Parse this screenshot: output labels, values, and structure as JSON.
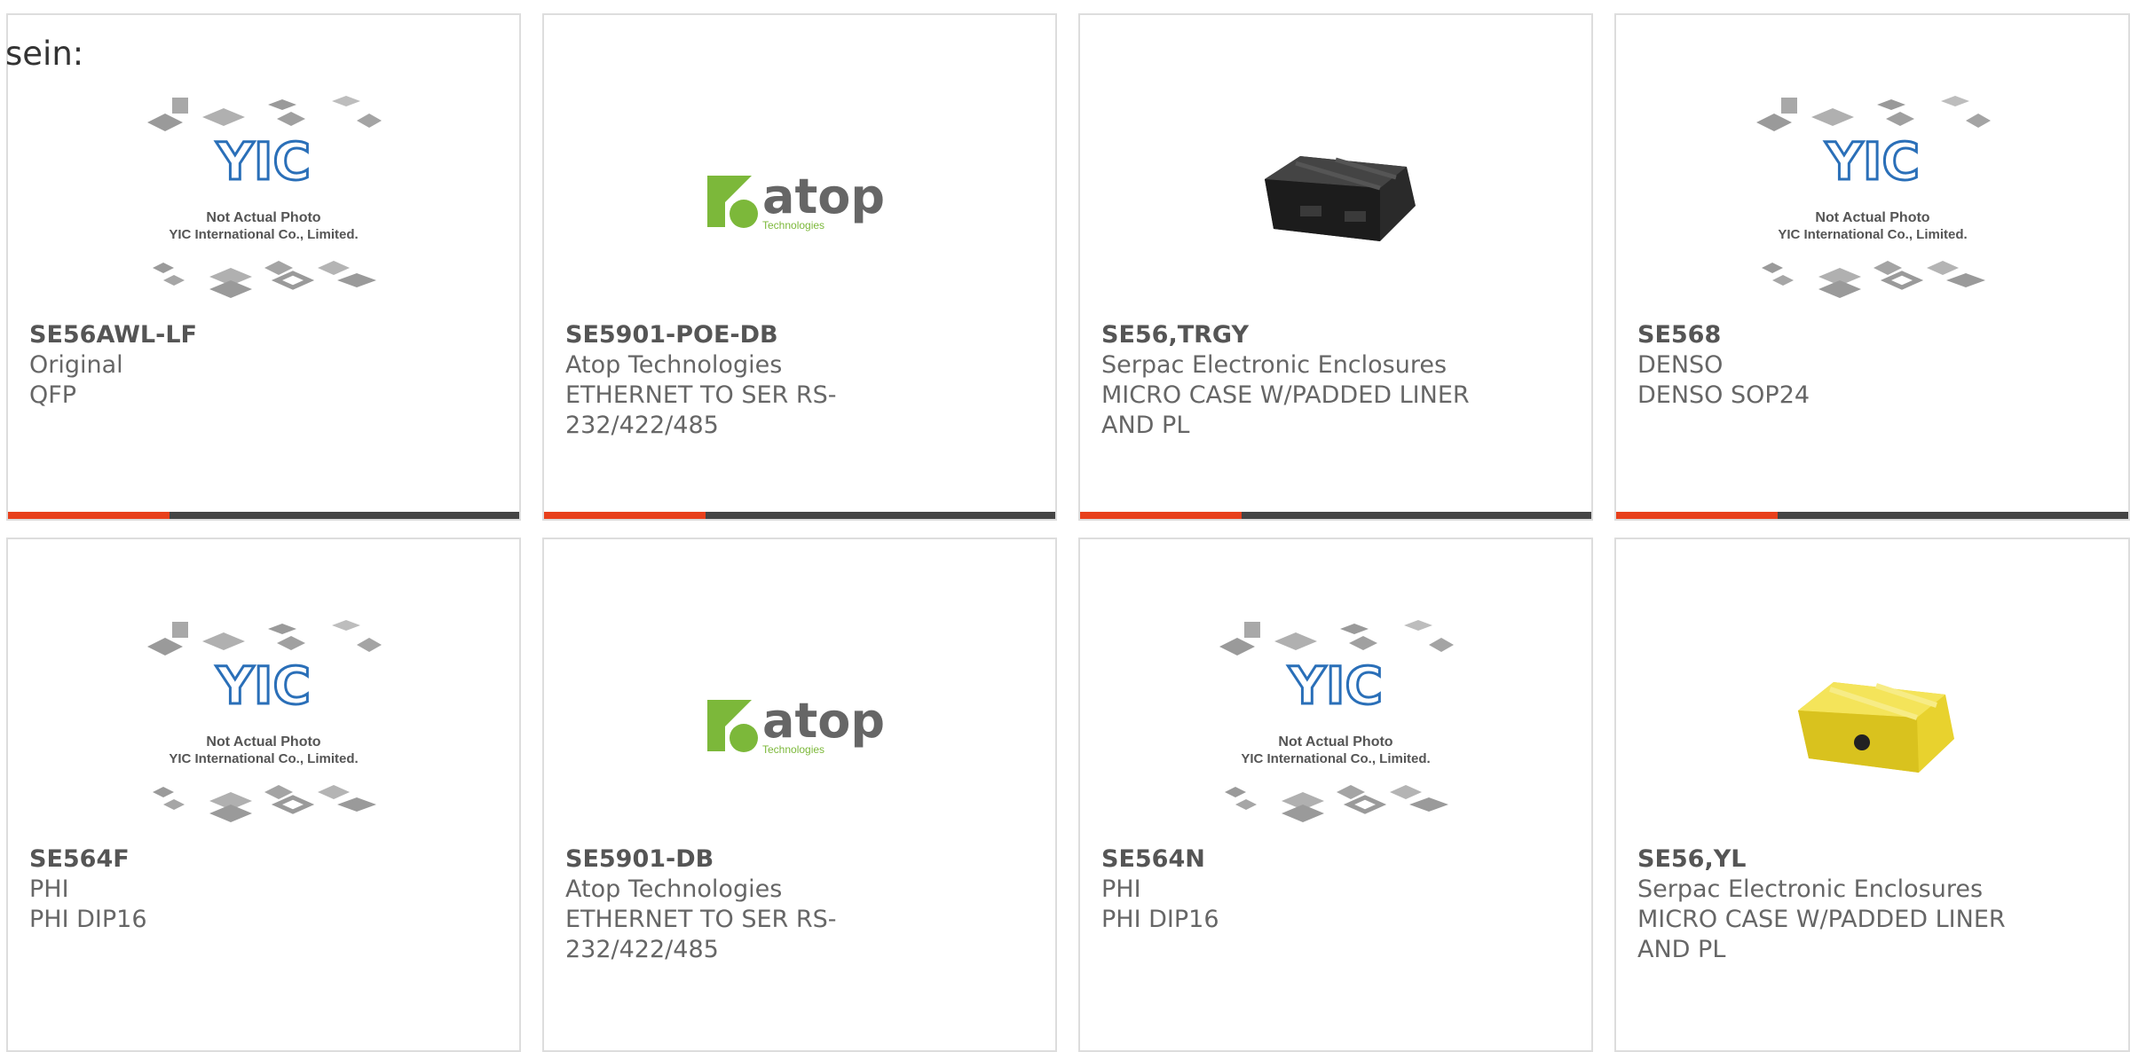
{
  "page": {
    "label": "sein:"
  },
  "colors": {
    "accent": "#e8401c",
    "bar_dark": "#444444",
    "yic_blue": "#2a6fb8",
    "atop_green": "#7cb83a",
    "case_yellow": "#f1de3a"
  },
  "placeholder_image": {
    "line1": "Not Actual Photo",
    "line2": "YIC International Co., Limited.",
    "logo": "YIC"
  },
  "atop_logo": {
    "brand": "atop",
    "sub": "Technologies"
  },
  "products": [
    {
      "part": "SE56AWL-LF",
      "maker": "Original",
      "desc": [
        "QFP"
      ],
      "image": "yic-placeholder"
    },
    {
      "part": "SE5901-POE-DB",
      "maker": "Atop Technologies",
      "desc": [
        "ETHERNET TO SER RS-",
        "232/422/485"
      ],
      "image": "atop-logo"
    },
    {
      "part": "SE56,TRGY",
      "maker": "Serpac Electronic Enclosures",
      "desc": [
        "MICRO CASE W/PADDED LINER",
        "AND PL"
      ],
      "image": "black-case"
    },
    {
      "part": "SE568",
      "maker": "DENSO",
      "desc": [
        "DENSO SOP24"
      ],
      "image": "yic-placeholder"
    },
    {
      "part": "SE564F",
      "maker": "PHI",
      "desc": [
        "PHI DIP16"
      ],
      "image": "yic-placeholder"
    },
    {
      "part": "SE5901-DB",
      "maker": "Atop Technologies",
      "desc": [
        "ETHERNET TO SER RS-",
        "232/422/485"
      ],
      "image": "atop-logo"
    },
    {
      "part": "SE564N",
      "maker": "PHI",
      "desc": [
        "PHI DIP16"
      ],
      "image": "yic-placeholder"
    },
    {
      "part": "SE56,YL",
      "maker": "Serpac Electronic Enclosures",
      "desc": [
        "MICRO CASE W/PADDED LINER",
        "AND PL"
      ],
      "image": "yellow-case"
    }
  ]
}
